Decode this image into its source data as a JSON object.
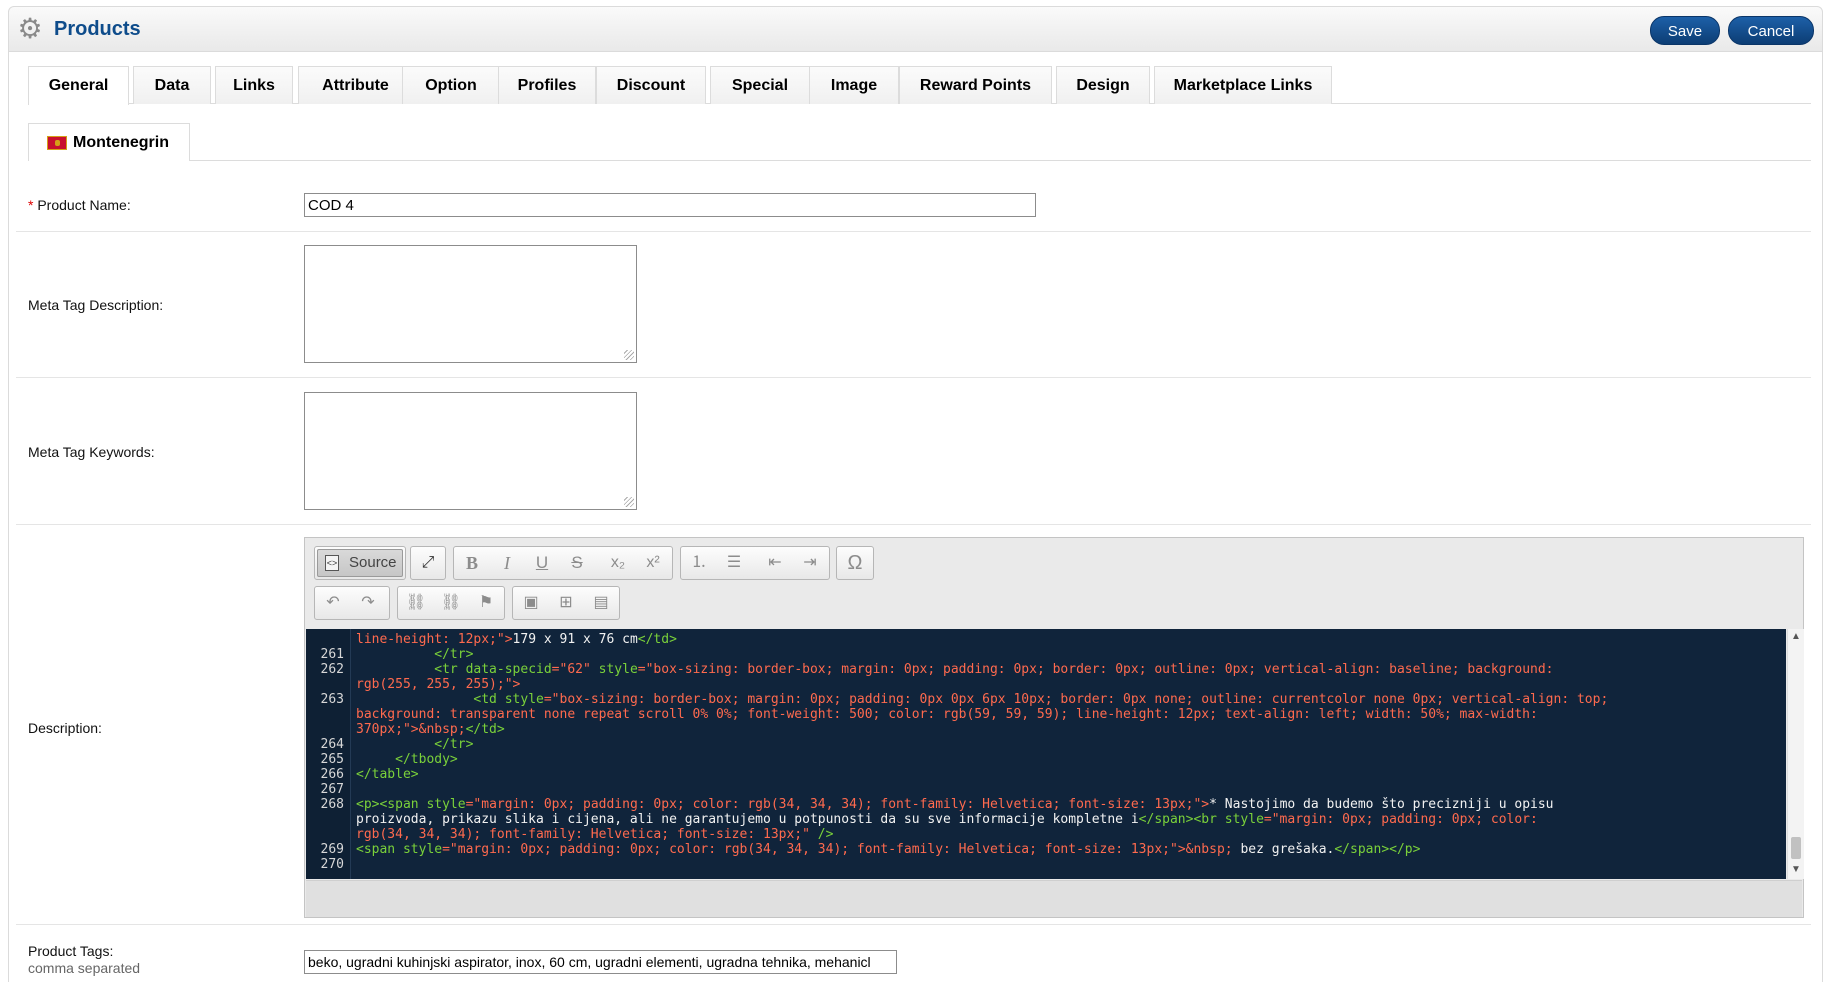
{
  "header": {
    "title": "Products",
    "save_label": "Save",
    "cancel_label": "Cancel",
    "brand_color": "#0e4c8b"
  },
  "tabs": [
    {
      "label": "General",
      "active": true
    },
    {
      "label": "Data"
    },
    {
      "label": "Links"
    },
    {
      "label": "Attribute"
    },
    {
      "label": "Option"
    },
    {
      "label": "Profiles"
    },
    {
      "label": "Discount"
    },
    {
      "label": "Special"
    },
    {
      "label": "Image"
    },
    {
      "label": "Reward Points"
    },
    {
      "label": "Design"
    },
    {
      "label": "Marketplace Links"
    }
  ],
  "language_tab": {
    "label": "Montenegrin"
  },
  "form": {
    "product_name_required": "*",
    "product_name_label": "Product Name:",
    "product_name_value": "COD 4",
    "meta_description_label": "Meta Tag Description:",
    "meta_keywords_label": "Meta Tag Keywords:",
    "description_label": "Description:",
    "tags_label": "Product Tags:",
    "tags_hint": "comma separated",
    "tags_value": "beko, ugradni kuhinjski aspirator, inox, 60 cm, ugradni elementi, ugradna tehnika, mehanicl"
  },
  "editor": {
    "source_label": "Source",
    "line_numbers": [
      "",
      "261",
      "262",
      "",
      "263",
      "",
      "",
      "264",
      "265",
      "266",
      "267",
      "268",
      "",
      "",
      "269",
      "270"
    ],
    "code_lines": [
      [
        {
          "c": "a",
          "t": "line-height: 12px;\">"
        },
        {
          "c": "p",
          "t": "179 x 91 x 76 cm"
        },
        {
          "c": "g",
          "t": "</td>"
        }
      ],
      [
        {
          "c": "g",
          "t": "          </tr>"
        }
      ],
      [
        {
          "c": "g",
          "t": "          <tr "
        },
        {
          "c": "g",
          "t": "data-specid"
        },
        {
          "c": "a",
          "t": "=\"62\" "
        },
        {
          "c": "g",
          "t": "style"
        },
        {
          "c": "a",
          "t": "=\"box-sizing: border-box; margin: 0px; padding: 0px; border: 0px; outline: 0px; vertical-align: baseline; background:"
        }
      ],
      [
        {
          "c": "a",
          "t": "rgb(255, 255, 255);\">"
        }
      ],
      [
        {
          "c": "g",
          "t": "               <td "
        },
        {
          "c": "g",
          "t": "style"
        },
        {
          "c": "a",
          "t": "=\"box-sizing: border-box; margin: 0px; padding: 0px 0px 6px 10px; border: 0px none; outline: currentcolor none 0px; vertical-align: top;"
        }
      ],
      [
        {
          "c": "a",
          "t": "background: transparent none repeat scroll 0% 0%; font-weight: 500; color: rgb(59, 59, 59); line-height: 12px; text-align: left; width: 50%; max-width:"
        }
      ],
      [
        {
          "c": "a",
          "t": "370px;\">&nbsp;"
        },
        {
          "c": "g",
          "t": "</td>"
        }
      ],
      [
        {
          "c": "g",
          "t": "          </tr>"
        }
      ],
      [
        {
          "c": "g",
          "t": "     </tbody>"
        }
      ],
      [
        {
          "c": "g",
          "t": "</table>"
        }
      ],
      [
        {
          "c": "p",
          "t": ""
        }
      ],
      [
        {
          "c": "g",
          "t": "<p><span "
        },
        {
          "c": "g",
          "t": "style"
        },
        {
          "c": "a",
          "t": "=\"margin: 0px; padding: 0px; color: rgb(34, 34, 34); font-family: Helvetica; font-size: 13px;\">"
        },
        {
          "c": "p",
          "t": "* Nastojimo da budemo što precizniji u opisu"
        }
      ],
      [
        {
          "c": "p",
          "t": "proizvoda, prikazu slika i cijena, ali ne garantujemo u potpunosti da su sve informacije kompletne i"
        },
        {
          "c": "g",
          "t": "</span><br "
        },
        {
          "c": "g",
          "t": "style"
        },
        {
          "c": "a",
          "t": "=\"margin: 0px; padding: 0px; color:"
        }
      ],
      [
        {
          "c": "a",
          "t": "rgb(34, 34, 34); font-family: Helvetica; font-size: 13px;\" "
        },
        {
          "c": "g",
          "t": "/>"
        }
      ],
      [
        {
          "c": "g",
          "t": "<span "
        },
        {
          "c": "g",
          "t": "style"
        },
        {
          "c": "a",
          "t": "=\"margin: 0px; padding: 0px; color: rgb(34, 34, 34); font-family: Helvetica; font-size: 13px;\">&nbsp; "
        },
        {
          "c": "p",
          "t": "bez grešaka."
        },
        {
          "c": "g",
          "t": "</span></p>"
        }
      ],
      [
        {
          "c": "p",
          "t": ""
        }
      ]
    ]
  }
}
